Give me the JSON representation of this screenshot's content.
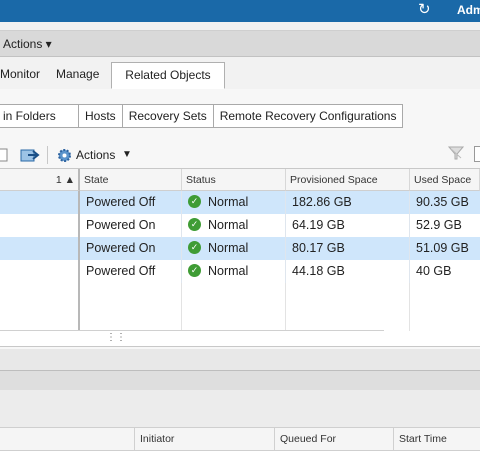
{
  "header": {
    "user": "Adm",
    "refresh_icon": "refresh-icon"
  },
  "actions_menu": {
    "label": "Actions ▾"
  },
  "tabs": [
    {
      "label": "Monitor"
    },
    {
      "label": "Manage"
    },
    {
      "label": "Related Objects",
      "active": true
    }
  ],
  "subtabs": [
    {
      "label": "es in Folders"
    },
    {
      "label": "Hosts"
    },
    {
      "label": "Recovery Sets"
    },
    {
      "label": "Remote Recovery Configurations"
    }
  ],
  "toolbar": {
    "actions_label": "Actions",
    "sort_indicator": "1 ▲"
  },
  "grid": {
    "columns": [
      "State",
      "Status",
      "Provisioned Space",
      "Used Space"
    ],
    "rows": [
      {
        "state": "Powered Off",
        "status": "Normal",
        "provisioned": "182.86  GB",
        "used": "90.35  GB",
        "selected": true
      },
      {
        "state": "Powered On",
        "status": "Normal",
        "provisioned": "64.19  GB",
        "used": "52.9  GB",
        "selected": false
      },
      {
        "state": "Powered On",
        "status": "Normal",
        "provisioned": "80.17  GB",
        "used": "51.09  GB",
        "selected": true
      },
      {
        "state": "Powered Off",
        "status": "Normal",
        "provisioned": "44.18  GB",
        "used": "40  GB",
        "selected": false
      }
    ]
  },
  "tasks": {
    "columns": [
      "Initiator",
      "Queued For",
      "Start Time"
    ]
  },
  "colors": {
    "accent": "#1a69a8",
    "row_selected": "#cfe6fb",
    "ok_green": "#3f9c35"
  }
}
